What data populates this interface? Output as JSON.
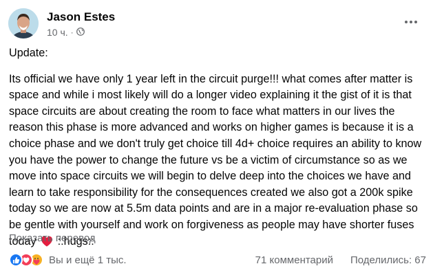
{
  "post": {
    "author": "Jason Estes",
    "time": "10 ч.",
    "separator": "·",
    "heading": "Update:",
    "body": "Its official we have only 1 year left in the circuit purge!!! what comes after matter is space and while i most likely will do a longer video explaining it the gist of it is that space circuits are about creating the room to face what matters in our lives the reason this phase is more advanced and works on higher games is because it is a choice phase and we don't truly get choice till 4d+ choice requires an ability to know you have the power to change the future vs be a victim of circumstance so as we move into space circuits we will begin to delve deep into the choices we have and learn to take responsibility for the consequences created we also got a 200k spike today so we are now at 5.5m data points and are in a major re-evaluation phase so be gentle with yourself and work on forgiveness as people may have shorter fuses today",
    "body_end": "::hugs::",
    "translate_label": "Показать перевод"
  },
  "footer": {
    "reactions": [
      "like-icon",
      "love-icon",
      "care-icon"
    ],
    "reaction_count": "Вы и ещё 1 тыс.",
    "comments": "71 комментарий",
    "shares": "Поделились: 67"
  },
  "colors": {
    "like": "#1877f2",
    "love": "#f33e58",
    "care": "#f7b125",
    "secondary_text": "#65676b"
  }
}
